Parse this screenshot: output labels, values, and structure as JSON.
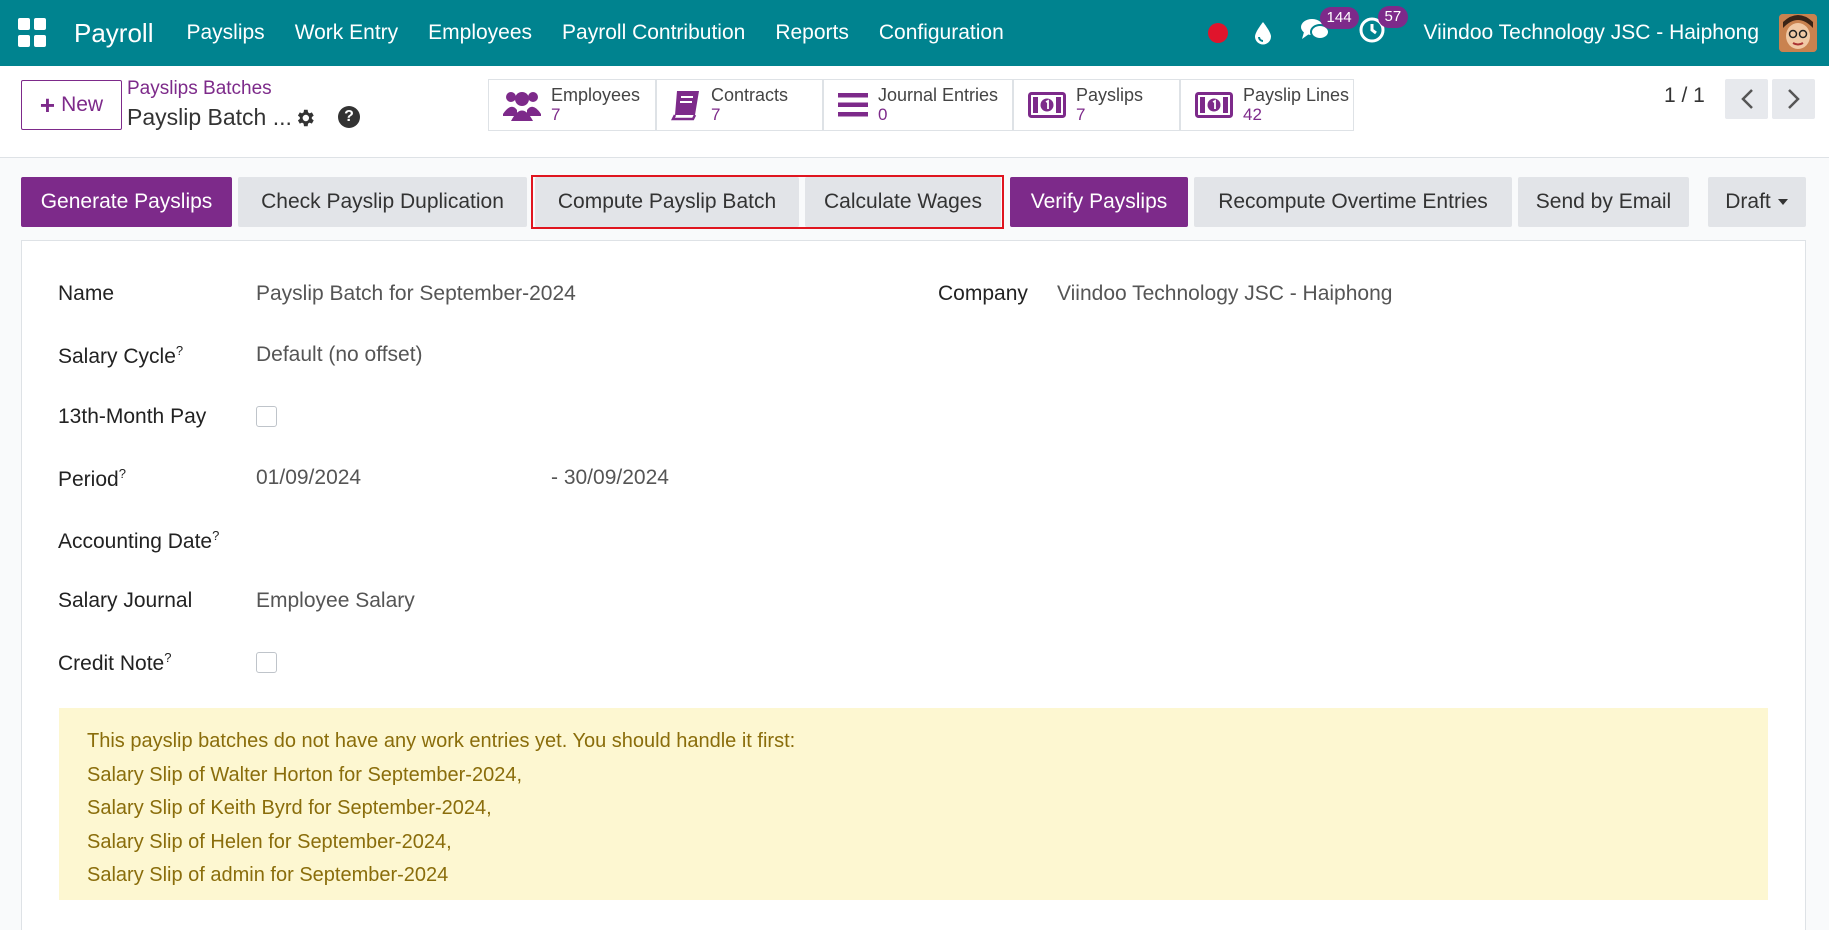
{
  "navbar": {
    "brand": "Payroll",
    "menu": [
      "Payslips",
      "Work Entry",
      "Employees",
      "Payroll Contribution",
      "Reports",
      "Configuration"
    ],
    "messages_count": "144",
    "activities_count": "57",
    "company": "Viindoo Technology JSC - Haiphong"
  },
  "control": {
    "new_label": "New",
    "breadcrumb": "Payslips Batches",
    "record_title": "Payslip Batch ...",
    "help_glyph": "?",
    "stats": [
      {
        "label": "Employees",
        "value": "7",
        "icon": "users-icon"
      },
      {
        "label": "Contracts",
        "value": "7",
        "icon": "book-icon"
      },
      {
        "label": "Journal Entries",
        "value": "0",
        "icon": "list-icon"
      },
      {
        "label": "Payslips",
        "value": "7",
        "icon": "money-icon"
      },
      {
        "label": "Payslip Lines",
        "value": "42",
        "icon": "money-icon"
      }
    ],
    "pager": "1 / 1"
  },
  "statusbar": {
    "generate": "Generate Payslips",
    "check_dup": "Check Payslip Duplication",
    "compute": "Compute Payslip Batch",
    "calculate": "Calculate Wages",
    "verify": "Verify Payslips",
    "recompute": "Recompute Overtime Entries",
    "send_email": "Send by Email",
    "state": "Draft"
  },
  "form": {
    "name_label": "Name",
    "name_value": "Payslip Batch for September-2024",
    "company_label": "Company",
    "company_value": "Viindoo Technology JSC - Haiphong",
    "salary_cycle_label": "Salary Cycle",
    "salary_cycle_value": "Default (no offset)",
    "thirteenth_label": "13th-Month Pay",
    "period_label": "Period",
    "period_from": "01/09/2024",
    "period_to": "- 30/09/2024",
    "accounting_date_label": "Accounting Date",
    "salary_journal_label": "Salary Journal",
    "salary_journal_value": "Employee Salary",
    "credit_note_label": "Credit Note",
    "help_mark": "?"
  },
  "alert": {
    "lines": [
      "This payslip batches do not have any work entries yet. You should handle it first:",
      "Salary Slip of Walter Horton for September-2024,",
      "Salary Slip of Keith Byrd for September-2024,",
      "Salary Slip of Helen for September-2024,",
      "Salary Slip of admin for September-2024"
    ]
  }
}
